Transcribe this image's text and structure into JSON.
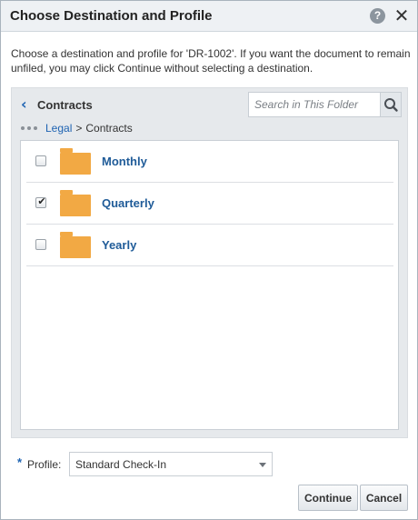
{
  "dialog": {
    "title": "Choose Destination and Profile",
    "help_icon": "help-icon",
    "close_icon": "close-icon",
    "instructions": "Choose a destination and profile for 'DR-1002'. If you want the document to remain unfiled, you may click Continue without selecting a destination."
  },
  "browser": {
    "current_folder": "Contracts",
    "search_placeholder": "Search in This Folder",
    "breadcrumb": {
      "parent": "Legal",
      "separator": ">",
      "current": "Contracts"
    },
    "items": [
      {
        "label": "Monthly",
        "checked": false,
        "icon": "folder-icon"
      },
      {
        "label": "Quarterly",
        "checked": true,
        "icon": "folder-icon"
      },
      {
        "label": "Yearly",
        "checked": false,
        "icon": "folder-icon"
      }
    ]
  },
  "profile": {
    "required_marker": "*",
    "label": "Profile:",
    "value": "Standard Check-In"
  },
  "buttons": {
    "continue": "Continue",
    "cancel": "Cancel"
  },
  "colors": {
    "accent": "#1e63b2",
    "folder": "#f2a944",
    "panel": "#e6e9ec"
  }
}
